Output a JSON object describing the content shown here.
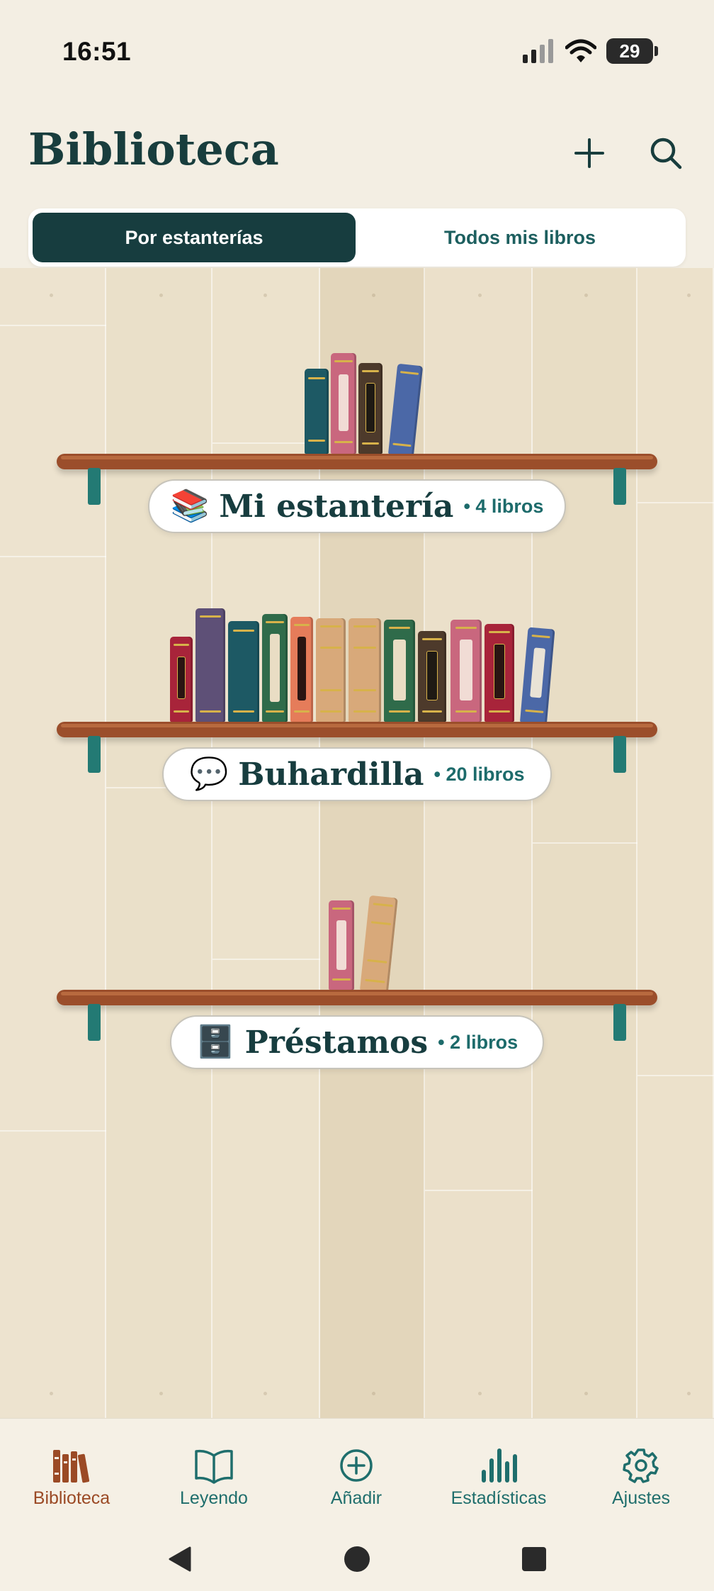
{
  "status_bar": {
    "time": "16:51",
    "battery": "29"
  },
  "header": {
    "title": "Biblioteca"
  },
  "segmented": {
    "tabs": [
      "Por estanterías",
      "Todos mis libros"
    ]
  },
  "shelves": [
    {
      "emoji": "📚",
      "name": "Mi estantería",
      "count": "• 4 libros"
    },
    {
      "emoji": "💬",
      "name": "Buhardilla",
      "count": "• 20 libros"
    },
    {
      "emoji": "🗄️",
      "name": "Préstamos",
      "count": "• 2 libros"
    }
  ],
  "bottom_nav": {
    "items": [
      "Biblioteca",
      "Leyendo",
      "Añadir",
      "Estadísticas",
      "Ajustes"
    ],
    "active": "Biblioteca"
  },
  "colors": {
    "primary": "#173d3f",
    "accent": "#9b4a25",
    "teal": "#1f6e6c",
    "background": "#f3eee3"
  }
}
